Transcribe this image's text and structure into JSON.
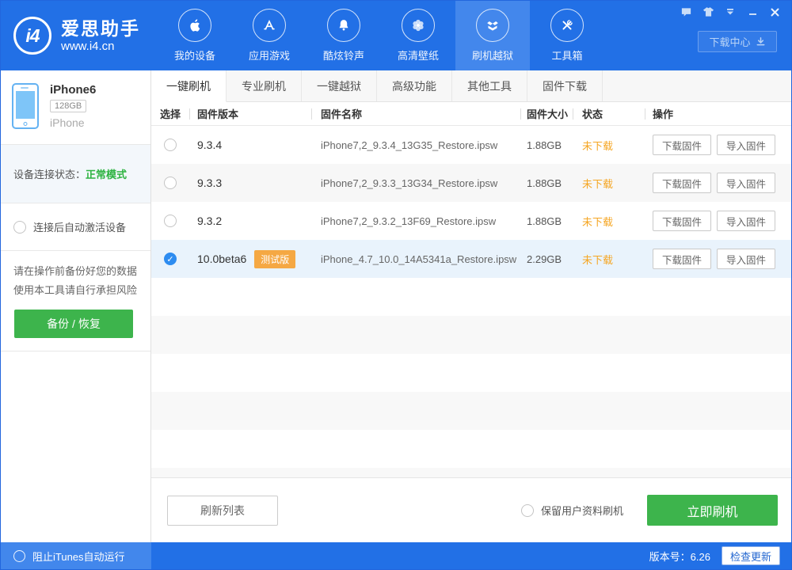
{
  "header": {
    "logo": {
      "mark": "i4",
      "title": "爱思助手",
      "subtitle": "www.i4.cn"
    },
    "nav": [
      {
        "label": "我的设备",
        "active": false
      },
      {
        "label": "应用游戏",
        "active": false
      },
      {
        "label": "酷炫铃声",
        "active": false
      },
      {
        "label": "高清壁纸",
        "active": false
      },
      {
        "label": "刷机越狱",
        "active": true
      },
      {
        "label": "工具箱",
        "active": false
      }
    ],
    "download_center_label": "下载中心"
  },
  "sidebar": {
    "device": {
      "name": "iPhone6",
      "capacity": "128GB",
      "model": "iPhone"
    },
    "connection_label": "设备连接状态：",
    "connection_status": "正常模式",
    "auto_activate_label": "连接后自动激活设备",
    "warning_line1": "请在操作前备份好您的数据",
    "warning_line2": "使用本工具请自行承担风险",
    "backup_restore_label": "备份 / 恢复"
  },
  "tabs": [
    {
      "label": "一键刷机",
      "active": true
    },
    {
      "label": "专业刷机",
      "active": false
    },
    {
      "label": "一键越狱",
      "active": false
    },
    {
      "label": "高级功能",
      "active": false
    },
    {
      "label": "其他工具",
      "active": false
    },
    {
      "label": "固件下载",
      "active": false
    }
  ],
  "table": {
    "headers": [
      "选择",
      "固件版本",
      "固件名称",
      "固件大小",
      "状态",
      "操作"
    ],
    "download_label": "下载固件",
    "import_label": "导入固件",
    "rows": [
      {
        "version": "9.3.4",
        "badge": "",
        "name": "iPhone7,2_9.3.4_13G35_Restore.ipsw",
        "size": "1.88GB",
        "status": "未下载",
        "selected": false
      },
      {
        "version": "9.3.3",
        "badge": "",
        "name": "iPhone7,2_9.3.3_13G34_Restore.ipsw",
        "size": "1.88GB",
        "status": "未下载",
        "selected": false
      },
      {
        "version": "9.3.2",
        "badge": "",
        "name": "iPhone7,2_9.3.2_13F69_Restore.ipsw",
        "size": "1.88GB",
        "status": "未下载",
        "selected": false
      },
      {
        "version": "10.0beta6",
        "badge": "测试版",
        "name": "iPhone_4.7_10.0_14A5341a_Restore.ipsw",
        "size": "2.29GB",
        "status": "未下载",
        "selected": true
      }
    ]
  },
  "bottom_bar": {
    "refresh_label": "刷新列表",
    "keep_data_label": "保留用户资料刷机",
    "flash_label": "立即刷机"
  },
  "footer": {
    "block_itunes_label": "阻止iTunes自动运行",
    "version_label": "版本号：6.26",
    "check_update_label": "检查更新"
  },
  "colors": {
    "header_blue": "#2270e6",
    "header_active_blue": "#4387ec",
    "accent_green": "#3db44c",
    "status_green": "#2db340",
    "status_orange": "#f5a623",
    "badge_orange": "#f5a843",
    "selected_row_blue": "#e9f3fc",
    "radio_checked_blue": "#2d8cf0"
  }
}
